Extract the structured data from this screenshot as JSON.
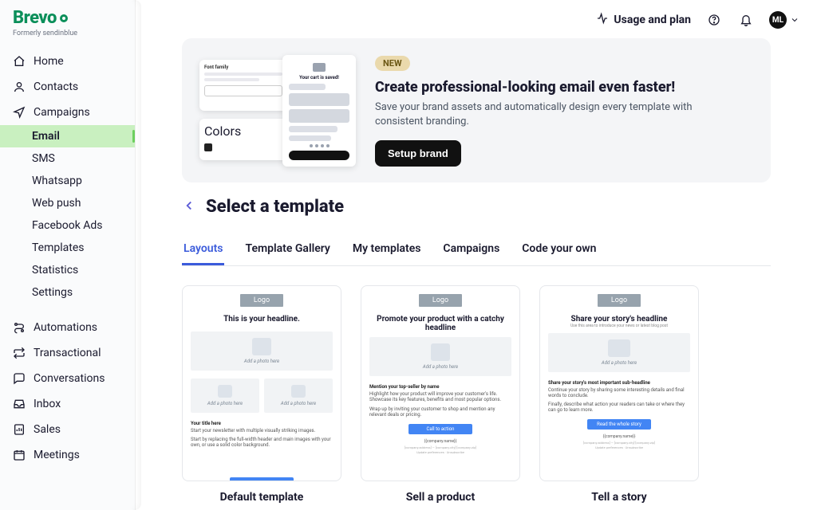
{
  "brand": {
    "name": "Brevo",
    "sub": "Formerly sendinblue"
  },
  "topbar": {
    "usage_label": "Usage and plan",
    "avatar_initials": "ML"
  },
  "sidebar": {
    "primary": [
      {
        "label": "Home",
        "icon": "home-icon"
      },
      {
        "label": "Contacts",
        "icon": "user-icon"
      },
      {
        "label": "Campaigns",
        "icon": "send-icon"
      }
    ],
    "campaign_children": [
      {
        "label": "Email",
        "active": true
      },
      {
        "label": "SMS"
      },
      {
        "label": "Whatsapp"
      },
      {
        "label": "Web push"
      },
      {
        "label": "Facebook Ads"
      },
      {
        "label": "Templates"
      },
      {
        "label": "Statistics"
      },
      {
        "label": "Settings"
      }
    ],
    "secondary": [
      {
        "label": "Automations",
        "icon": "automation-icon"
      },
      {
        "label": "Transactional",
        "icon": "repeat-icon"
      },
      {
        "label": "Conversations",
        "icon": "chat-icon"
      },
      {
        "label": "Inbox",
        "icon": "inbox-icon"
      },
      {
        "label": "Sales",
        "icon": "report-icon"
      },
      {
        "label": "Meetings",
        "icon": "calendar-icon"
      }
    ]
  },
  "banner": {
    "badge": "NEW",
    "title": "Create professional-looking email even faster!",
    "body": "Save your brand assets and automatically design every template with consistent branding.",
    "cta": "Setup brand",
    "thumb": {
      "font_label": "Font family",
      "colors_label": "Colors",
      "preview_headline": "Your cart is saved!"
    }
  },
  "page": {
    "title": "Select a template"
  },
  "tabs": [
    {
      "label": "Layouts",
      "active": true
    },
    {
      "label": "Template Gallery"
    },
    {
      "label": "My templates"
    },
    {
      "label": "Campaigns"
    },
    {
      "label": "Code your own"
    }
  ],
  "templates": [
    {
      "name": "Default template",
      "logo": "Logo",
      "headline": "This is your headline.",
      "photo_caption": "Add a photo here",
      "section_title": "Your title here",
      "section_lines": [
        "Start your newsletter with multiple visually striking images.",
        "Start by replacing the full-width header and main images with your own, or use a solid color background."
      ]
    },
    {
      "name": "Sell a product",
      "logo": "Logo",
      "headline": "Promote your product with a catchy headline",
      "photo_caption": "Add a photo here",
      "sub_title": "Mention your top-seller by name",
      "sub_lines": [
        "Highlight how your product will improve your customer's life. Showcase its key features, benefits and most popular options.",
        "Wrap up by inviting your customer to shop and mention any relevant deals or pricing."
      ],
      "cta": "Call to action",
      "footer": "{{company.name}}"
    },
    {
      "name": "Tell a story",
      "logo": "Logo",
      "headline": "Share your story's headline",
      "headline_sub": "Use this area to introduce your news or latest blog post",
      "photo_caption": "Add a photo here",
      "sub_title": "Share your story's most important sub-headline",
      "sub_lines": [
        "Continue your story by sharing some interesting details and final words to conclude.",
        "Finally, describe what action your readers can take or where they can go to learn more."
      ],
      "cta": "Read the whole story",
      "footer": "{{company.name}}"
    }
  ]
}
